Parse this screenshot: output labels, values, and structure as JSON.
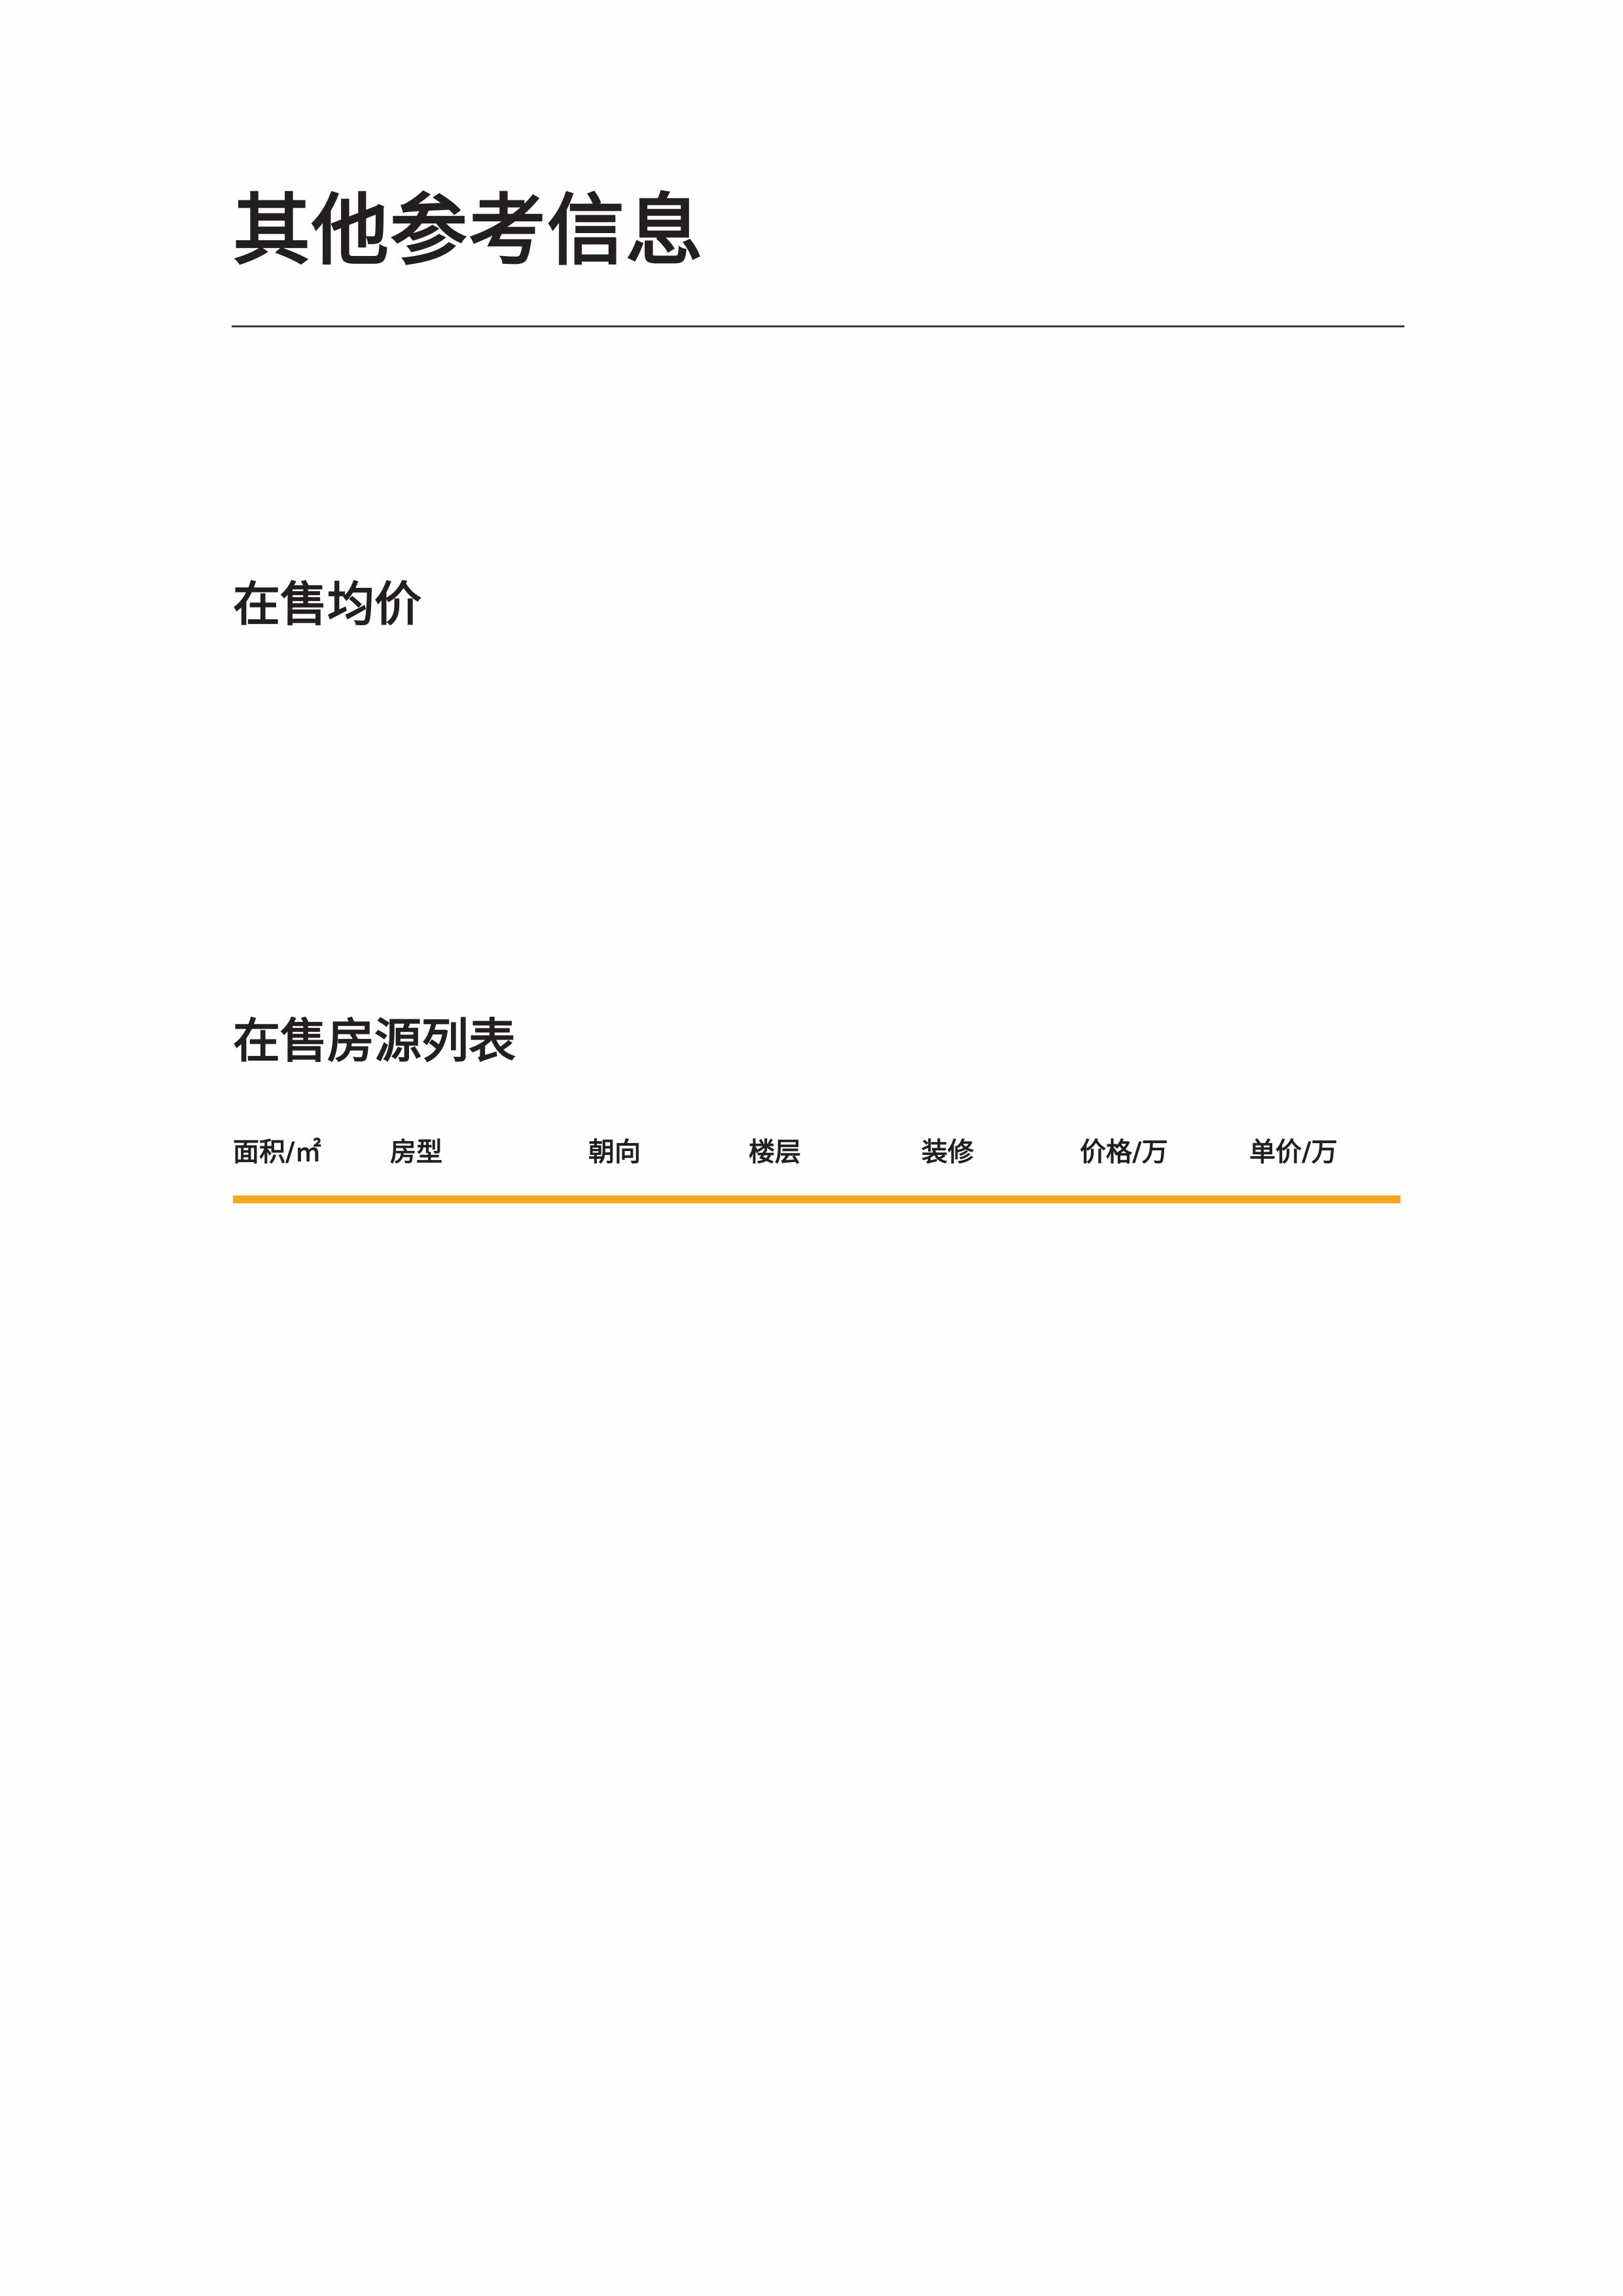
{
  "page": {
    "title": "其他参考信息"
  },
  "sections": {
    "average_price": {
      "heading": "在售均价"
    },
    "listings": {
      "heading": "在售房源列表",
      "columns": [
        "面积/㎡",
        "房型",
        "朝向",
        "楼层",
        "装修",
        "价格/万",
        "单价/万"
      ]
    }
  },
  "colors": {
    "accent": "#f5a623",
    "text": "#231f20",
    "rule": "#3a3a3a"
  }
}
